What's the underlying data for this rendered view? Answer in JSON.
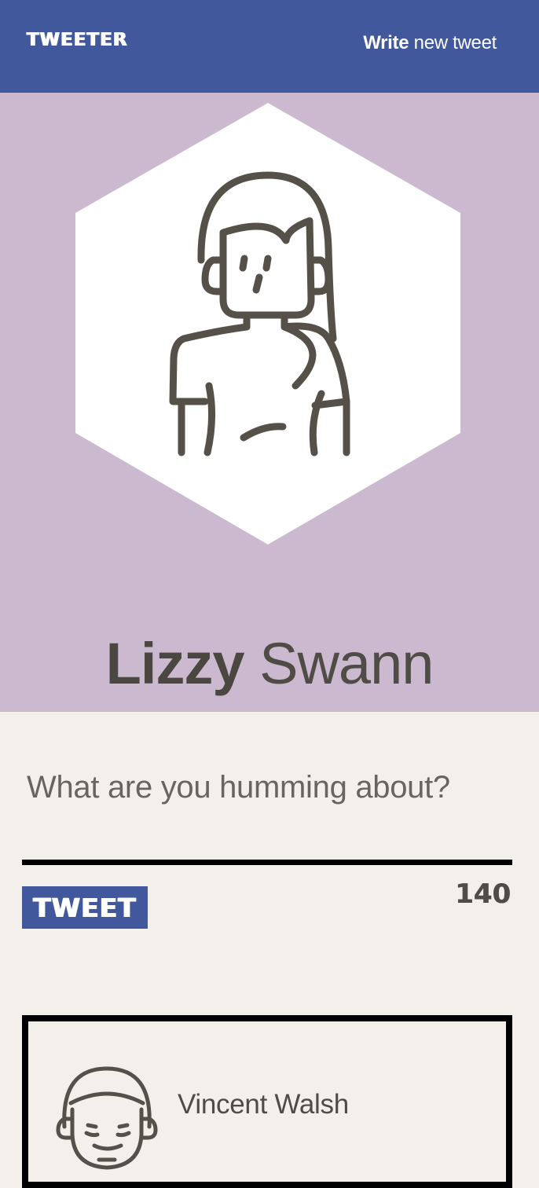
{
  "navbar": {
    "logo": "TWEETER",
    "write_strong": "Write",
    "write_light": "new tweet"
  },
  "profile": {
    "first_name": "Lizzy",
    "last_name": "Swann",
    "avatar_icon": "woman-avatar-icon"
  },
  "composer": {
    "placeholder": "What are you humming about?",
    "submit_label": "TWEET",
    "char_count": "140"
  },
  "tweets": [
    {
      "author": "Vincent Walsh",
      "avatar_icon": "man-avatar-icon"
    }
  ],
  "colors": {
    "navbar": "#42589c",
    "header_bg": "#cbb9cf",
    "page_bg": "#f3f0eb",
    "text": "#4f4c46"
  }
}
